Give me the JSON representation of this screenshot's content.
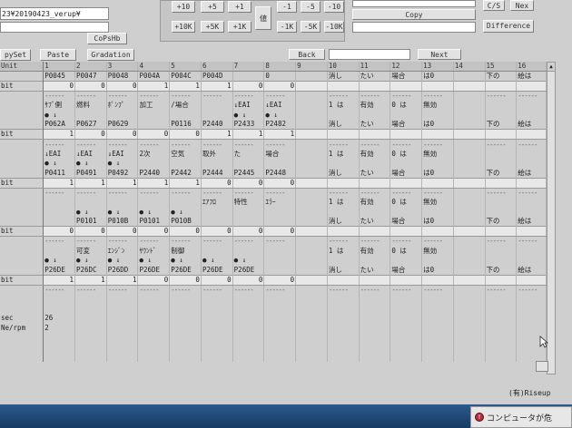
{
  "toolbar": {
    "project_field": "23¥20190423_verup¥",
    "copfile_label": "CoPsHb",
    "copyset_label": "pySet",
    "paste_label": "Paste",
    "gradation_label": "Gradation",
    "plus_row1": [
      "+10",
      "+5",
      "+1"
    ],
    "minus_row1": [
      "-1",
      "-5",
      "-10"
    ],
    "plus_row2": [
      "+10K",
      "+5K",
      "+1K"
    ],
    "minus_row2": [
      "-1K",
      "-5K",
      "-10K"
    ],
    "value_label": "値",
    "copy_label": "Copy",
    "difference_label": "Difference",
    "cls_label": "C/S",
    "next_top_label": "Nex",
    "back_label": "Back",
    "next_label": "Next"
  },
  "grid": {
    "header": [
      "Unit",
      "1",
      "2",
      "3",
      "4",
      "5",
      "6",
      "7",
      "8",
      "9",
      "10",
      "11",
      "12",
      "13",
      "14",
      "15",
      "16"
    ],
    "rows": [
      {
        "type": "data",
        "cells": [
          "",
          "P0045",
          "P0047",
          "P0048",
          "P004A",
          "P004C",
          "P004D",
          "",
          "0",
          "",
          "消し",
          "たい",
          "場合",
          "は0",
          "",
          "下の",
          "絵は"
        ]
      },
      {
        "type": "bit",
        "cells": [
          "bit",
          "0",
          "0",
          "0",
          "1",
          "1",
          "1",
          "0",
          "0",
          "",
          "",
          "",
          "",
          "",
          "",
          "",
          ""
        ]
      },
      {
        "type": "dash",
        "cells": [
          "",
          "------",
          "------",
          "------",
          "------",
          "------",
          "------",
          "------",
          "------",
          "",
          "------",
          "------",
          "------",
          "------",
          "",
          "------",
          "------"
        ]
      },
      {
        "type": "data",
        "cells": [
          "",
          "ｻﾌﾞ側",
          "燃料",
          "ﾎﾟﾝﾌﾟ",
          "加工",
          "/場合",
          "",
          "↓EAI",
          "↓EAI",
          "",
          "1 は",
          "有効",
          "0 は",
          "無効",
          "",
          "",
          ""
        ]
      },
      {
        "type": "data",
        "cells": [
          "",
          "● ↓",
          "",
          "",
          "",
          "",
          "",
          "● ↓",
          "● ↓",
          "",
          "",
          "",
          "",
          "",
          "",
          "",
          ""
        ]
      },
      {
        "type": "data",
        "cells": [
          "",
          "P062A",
          "P0627",
          "P0629",
          "",
          "P0116",
          "P2440",
          "P2433",
          "P2482",
          "",
          "消し",
          "たい",
          "場合",
          "は0",
          "",
          "下の",
          "絵は"
        ]
      },
      {
        "type": "bit",
        "cells": [
          "bit",
          "1",
          "0",
          "0",
          "0",
          "0",
          "1",
          "1",
          "1",
          "",
          "",
          "",
          "",
          "",
          "",
          "",
          ""
        ]
      },
      {
        "type": "dash",
        "cells": [
          "",
          "------",
          "------",
          "------",
          "------",
          "------",
          "------",
          "------",
          "------",
          "",
          "------",
          "------",
          "------",
          "------",
          "",
          "------",
          "------"
        ]
      },
      {
        "type": "data",
        "cells": [
          "",
          "↓EAI",
          "↓EAI",
          "↓EAI",
          "2次",
          "空気",
          "取外",
          "た",
          "場合",
          "",
          "1 は",
          "有効",
          "0 は",
          "無効",
          "",
          "",
          ""
        ]
      },
      {
        "type": "data",
        "cells": [
          "",
          "● ↓",
          "● ↓",
          "● ↓",
          "",
          "",
          "",
          "",
          "",
          "",
          "",
          "",
          "",
          "",
          "",
          "",
          ""
        ]
      },
      {
        "type": "data",
        "cells": [
          "",
          "P0411",
          "P0491",
          "P0492",
          "P2440",
          "P2442",
          "P2444",
          "P2445",
          "P2448",
          "",
          "消し",
          "たい",
          "場合",
          "は0",
          "",
          "下の",
          "絵は"
        ]
      },
      {
        "type": "bit",
        "cells": [
          "bit",
          "1",
          "1",
          "1",
          "1",
          "1",
          "0",
          "0",
          "0",
          "",
          "",
          "",
          "",
          "",
          "",
          "",
          ""
        ]
      },
      {
        "type": "dash",
        "cells": [
          "",
          "------",
          "------",
          "------",
          "------",
          "------",
          "------",
          "------",
          "------",
          "",
          "------",
          "------",
          "------",
          "------",
          "",
          "------",
          "------"
        ]
      },
      {
        "type": "data",
        "cells": [
          "",
          "",
          "",
          "",
          "",
          "",
          "ｴｱﾌﾛ",
          "特性",
          "ｴﾗｰ",
          "",
          "1 は",
          "有効",
          "0 は",
          "無効",
          "",
          "",
          ""
        ]
      },
      {
        "type": "data",
        "cells": [
          "",
          "",
          "● ↓",
          "● ↓",
          "● ↓",
          "● ↓",
          "",
          "",
          "",
          "",
          "",
          "",
          "",
          "",
          "",
          "",
          ""
        ]
      },
      {
        "type": "data",
        "cells": [
          "",
          "",
          "P0101",
          "P010B",
          "P0101",
          "P010B",
          "",
          "",
          "",
          "",
          "消し",
          "たい",
          "場合",
          "は0",
          "",
          "下の",
          "絵は"
        ]
      },
      {
        "type": "bit",
        "cells": [
          "bit",
          "0",
          "0",
          "0",
          "0",
          "0",
          "0",
          "0",
          "0",
          "",
          "",
          "",
          "",
          "",
          "",
          "",
          ""
        ]
      },
      {
        "type": "dash",
        "cells": [
          "",
          "------",
          "------",
          "------",
          "------",
          "------",
          "------",
          "------",
          "------",
          "",
          "------",
          "------",
          "------",
          "------",
          "",
          "------",
          "------"
        ]
      },
      {
        "type": "data",
        "cells": [
          "",
          "",
          "可変",
          "ｴﾝｼﾞﾝ",
          "ｻｳﾝﾄﾞ",
          "制御",
          "",
          "",
          "",
          "",
          "1 は",
          "有効",
          "0 は",
          "無効",
          "",
          "",
          ""
        ]
      },
      {
        "type": "data",
        "cells": [
          "",
          "● ↓",
          "● ↓",
          "● ↓",
          "● ↓",
          "● ↓",
          "● ↓",
          "● ↓",
          "",
          "",
          "",
          "",
          "",
          "",
          "",
          "",
          ""
        ]
      },
      {
        "type": "data",
        "cells": [
          "",
          "P26DE",
          "P26DC",
          "P26DD",
          "P26DE",
          "P26DE",
          "P26DE",
          "P26DE",
          "",
          "",
          "消し",
          "たい",
          "場合",
          "は0",
          "",
          "下の",
          "絵は"
        ]
      },
      {
        "type": "bit",
        "cells": [
          "bit",
          "1",
          "1",
          "1",
          "0",
          "0",
          "0",
          "0",
          "0",
          "",
          "",
          "",
          "",
          "",
          "",
          "",
          ""
        ]
      },
      {
        "type": "dash",
        "cells": [
          "",
          "------",
          "------",
          "------",
          "------",
          "------",
          "------",
          "------",
          "------",
          "",
          "------",
          "------",
          "------",
          "------",
          "",
          "------",
          "------"
        ]
      },
      {
        "type": "data",
        "cells": [
          "",
          "",
          "",
          "",
          "",
          "",
          "",
          "",
          "",
          "",
          "",
          "",
          "",
          "",
          "",
          "",
          ""
        ]
      },
      {
        "type": "data",
        "cells": [
          "",
          "",
          "",
          "",
          "",
          "",
          "",
          "",
          "",
          "",
          "",
          "",
          "",
          "",
          "",
          "",
          ""
        ]
      },
      {
        "type": "data",
        "cells": [
          "sec",
          "26",
          "",
          "",
          "",
          "",
          "",
          "",
          "",
          "",
          "",
          "",
          "",
          "",
          "",
          "",
          ""
        ]
      },
      {
        "type": "data",
        "cells": [
          "Ne/rpm",
          "2",
          "",
          "",
          "",
          "",
          "",
          "",
          "",
          "",
          "",
          "",
          "",
          "",
          "",
          "",
          ""
        ]
      },
      {
        "type": "data",
        "cells": [
          "",
          "",
          "",
          "",
          "",
          "",
          "",
          "",
          "",
          "",
          "",
          "",
          "",
          "",
          "",
          "",
          ""
        ]
      },
      {
        "type": "data",
        "cells": [
          "",
          "",
          "",
          "",
          "",
          "",
          "",
          "",
          "",
          "",
          "",
          "",
          "",
          "",
          "",
          "",
          ""
        ]
      },
      {
        "type": "data",
        "cells": [
          "",
          "",
          "",
          "",
          "",
          "",
          "",
          "",
          "",
          "",
          "",
          "",
          "",
          "",
          "",
          "",
          ""
        ]
      }
    ]
  },
  "status": {
    "corner_text": "(有)Riseup",
    "notification": "コンピュータが危"
  },
  "icons": {
    "scroll_up": "scroll-up-icon",
    "cursor": "mouse-cursor-icon",
    "notify": "shield-alert-icon"
  }
}
